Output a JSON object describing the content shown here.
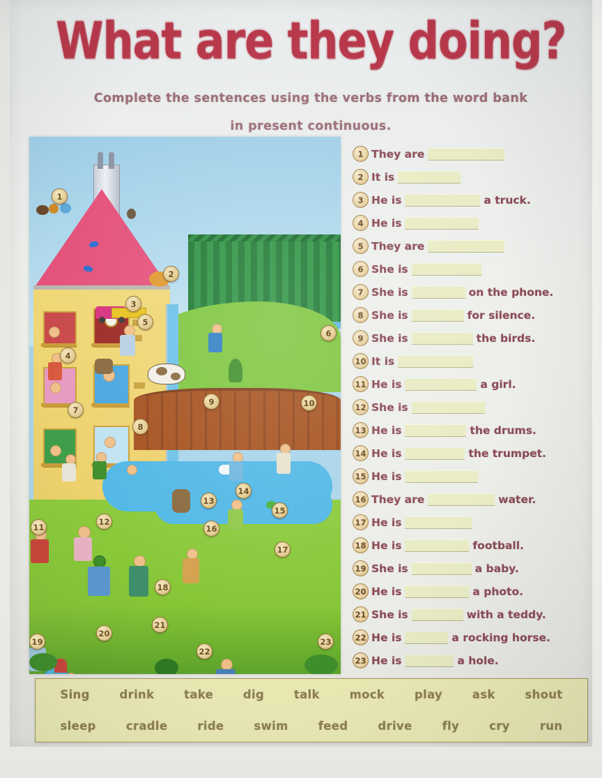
{
  "worksheet": {
    "title": "What are they doing?",
    "subtitle_line1": "Complete the sentences using the verbs from the word bank",
    "subtitle_line2": "in present continuous.",
    "title_color": "#b8384a",
    "text_color": "#8a4a55"
  },
  "illustration": {
    "name": "village-scene-picture",
    "markers": [
      "1",
      "2",
      "3",
      "4",
      "5",
      "6",
      "7",
      "8",
      "9",
      "10",
      "11",
      "12",
      "13",
      "14",
      "15",
      "16",
      "17",
      "18",
      "19",
      "20",
      "21",
      "22",
      "23"
    ]
  },
  "sentences": [
    {
      "n": "1",
      "pre": "They are",
      "blank": 110,
      "post": ""
    },
    {
      "n": "2",
      "pre": "It is",
      "blank": 90,
      "post": ""
    },
    {
      "n": "3",
      "pre": "He is",
      "blank": 108,
      "post": "a truck."
    },
    {
      "n": "4",
      "pre": "He is",
      "blank": 106,
      "post": ""
    },
    {
      "n": "5",
      "pre": "They are",
      "blank": 110,
      "post": ""
    },
    {
      "n": "6",
      "pre": "She is",
      "blank": 100,
      "post": ""
    },
    {
      "n": "7",
      "pre": "She is",
      "blank": 77,
      "post": "on the phone."
    },
    {
      "n": "8",
      "pre": "She is",
      "blank": 75,
      "post": "for silence."
    },
    {
      "n": "9",
      "pre": "She is",
      "blank": 88,
      "post": "the birds."
    },
    {
      "n": "10",
      "pre": "It is",
      "blank": 108,
      "post": ""
    },
    {
      "n": "11",
      "pre": "He is",
      "blank": 103,
      "post": "a girl."
    },
    {
      "n": "12",
      "pre": "She is",
      "blank": 105,
      "post": ""
    },
    {
      "n": "13",
      "pre": "He is",
      "blank": 88,
      "post": "the drums."
    },
    {
      "n": "14",
      "pre": "He is",
      "blank": 86,
      "post": "the trumpet."
    },
    {
      "n": "15",
      "pre": "He is",
      "blank": 105,
      "post": ""
    },
    {
      "n": "16",
      "pre": "They are",
      "blank": 96,
      "post": "water."
    },
    {
      "n": "17",
      "pre": "He is",
      "blank": 96,
      "post": ""
    },
    {
      "n": "18",
      "pre": "He is",
      "blank": 92,
      "post": "football."
    },
    {
      "n": "19",
      "pre": "She is",
      "blank": 86,
      "post": "a baby."
    },
    {
      "n": "20",
      "pre": "He is",
      "blank": 92,
      "post": "a photo."
    },
    {
      "n": "21",
      "pre": "She is",
      "blank": 74,
      "post": "with a teddy."
    },
    {
      "n": "22",
      "pre": "He is",
      "blank": 62,
      "post": "a rocking horse."
    },
    {
      "n": "23",
      "pre": "He is",
      "blank": 70,
      "post": "a hole."
    }
  ],
  "word_bank": {
    "row1": [
      "Sing",
      "drink",
      "take",
      "dig",
      "talk",
      "mock",
      "play",
      "ask",
      "shout"
    ],
    "row2": [
      "sleep",
      "cradle",
      "ride",
      "swim",
      "feed",
      "drive",
      "fly",
      "cry",
      "run"
    ]
  }
}
